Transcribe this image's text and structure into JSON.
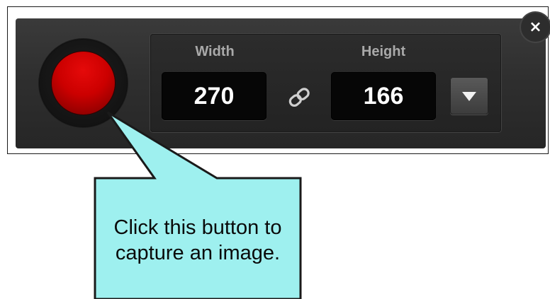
{
  "toolbar": {
    "width_label": "Width",
    "height_label": "Height",
    "width_value": "270",
    "height_value": "166",
    "close_glyph": "×",
    "icons": {
      "record": "record-button",
      "link": "link-icon",
      "dropdown": "triangle-down-icon",
      "close": "close-icon"
    },
    "colors": {
      "record_red": "#cc0000",
      "panel_dark": "#2f2f2f",
      "label_gray": "#a9a9a9",
      "value_white": "#ffffff"
    }
  },
  "callout": {
    "text": "Click this button to capture an image.",
    "fill_color": "#9ef0ef",
    "border_color": "#1a1a1a"
  }
}
